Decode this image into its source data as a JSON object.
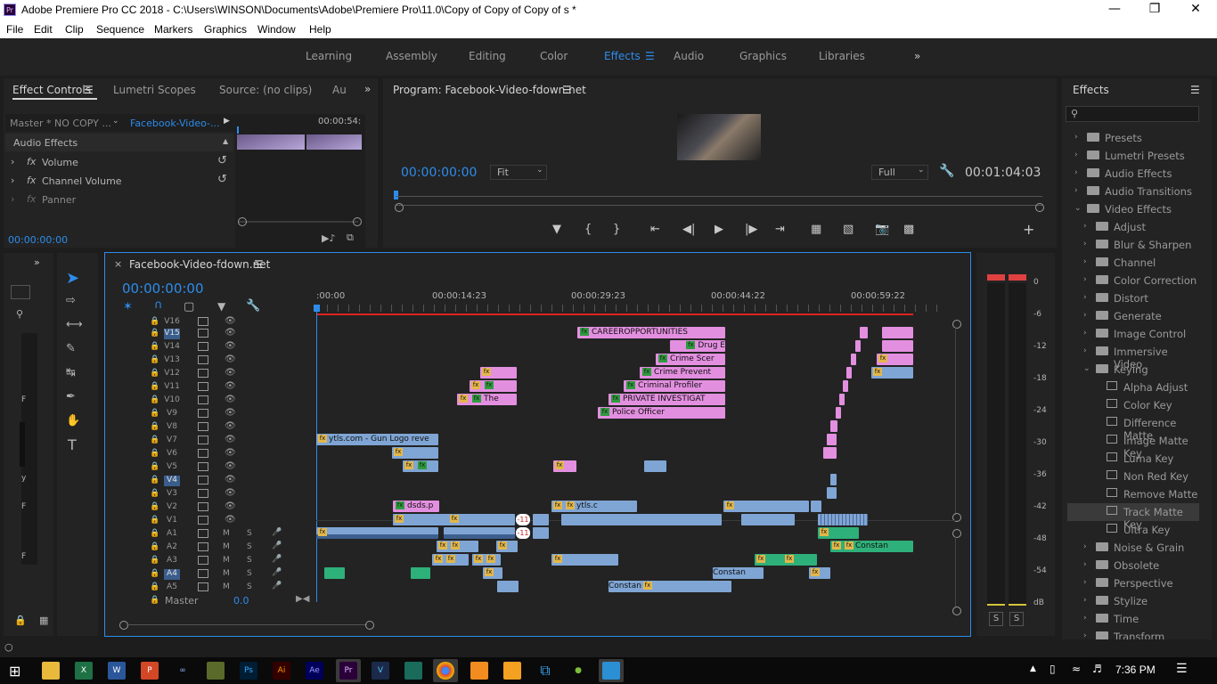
{
  "window": {
    "title": "Adobe Premiere Pro CC 2018 - C:\\Users\\WINSON\\Documents\\Adobe\\Premiere Pro\\11.0\\Copy of Copy of Copy of s *"
  },
  "menu": [
    "File",
    "Edit",
    "Clip",
    "Sequence",
    "Markers",
    "Graphics",
    "Window",
    "Help"
  ],
  "workspaces": [
    "Learning",
    "Assembly",
    "Editing",
    "Color",
    "Effects",
    "Audio",
    "Graphics",
    "Libraries"
  ],
  "workspace_active": "Effects",
  "effect_controls": {
    "tabs": [
      "Effect Controls",
      "Lumetri Scopes",
      "Source: (no clips)",
      "Au"
    ],
    "master_label": "Master * NO COPY ...",
    "sequence_label": "Facebook-Video-...",
    "time_marker": "00:00:54:",
    "section": "Audio Effects",
    "effects": [
      "Volume",
      "Channel Volume",
      "Panner"
    ],
    "timecode": "00:00:00:00"
  },
  "program": {
    "title": "Program: Facebook-Video-fdown.net",
    "timecode": "00:00:00:00",
    "fit": "Fit",
    "quality": "Full",
    "duration": "00:01:04:03"
  },
  "timeline": {
    "tab": "Facebook-Video-fdown.net",
    "timecode": "00:00:00:00",
    "ruler": [
      ":00:00",
      "00:00:14:23",
      "00:00:29:23",
      "00:00:44:22",
      "00:00:59:22"
    ],
    "video_tracks": [
      "V16",
      "V15",
      "V14",
      "V13",
      "V12",
      "V11",
      "V10",
      "V9",
      "V8",
      "V7",
      "V6",
      "V5",
      "V4",
      "V3",
      "V2",
      "V1"
    ],
    "audio_tracks": [
      "A1",
      "A2",
      "A3",
      "A4",
      "A5"
    ],
    "master": {
      "label": "Master",
      "value": "0.0"
    },
    "mute_label": "M",
    "solo_label": "S",
    "clip_labels": {
      "career": "CAREEROPPORTUNITIES",
      "drug": "Drug E",
      "crime_scene": "Crime Scer",
      "crime_prevent": "Crime Prevent",
      "criminal": "Criminal Profiler",
      "private": "PRIVATE INVESTIGAT",
      "police": "Police Officer",
      "the": "The",
      "ytls_gun": "ytls.com - Gun Logo reve",
      "dsds": "dsds.p",
      "ytls": "ytls.c",
      "constant": "Constan",
      "badge": "-11"
    }
  },
  "effects_panel": {
    "title": "Effects",
    "folders": [
      "Presets",
      "Lumetri Presets",
      "Audio Effects",
      "Audio Transitions",
      "Video Effects"
    ],
    "video_effects": [
      "Adjust",
      "Blur & Sharpen",
      "Channel",
      "Color Correction",
      "Distort",
      "Generate",
      "Image Control",
      "Immersive Video",
      "Keying"
    ],
    "keying_items": [
      "Alpha Adjust",
      "Color Key",
      "Difference Matte",
      "Image Matte Key",
      "Luma Key",
      "Non Red Key",
      "Remove Matte",
      "Track Matte Key",
      "Ultra Key"
    ],
    "after_items": [
      "Noise & Grain",
      "Obsolete",
      "Perspective",
      "Stylize",
      "Time",
      "Transform"
    ],
    "selected": "Track Matte Key"
  },
  "meter": {
    "scale": [
      "0",
      "-6",
      "-12",
      "-18",
      "-24",
      "-30",
      "-36",
      "-42",
      "-48",
      "-54",
      "dB"
    ],
    "solo": [
      "S",
      "S"
    ]
  },
  "taskbar": {
    "time": "7:36 PM"
  }
}
